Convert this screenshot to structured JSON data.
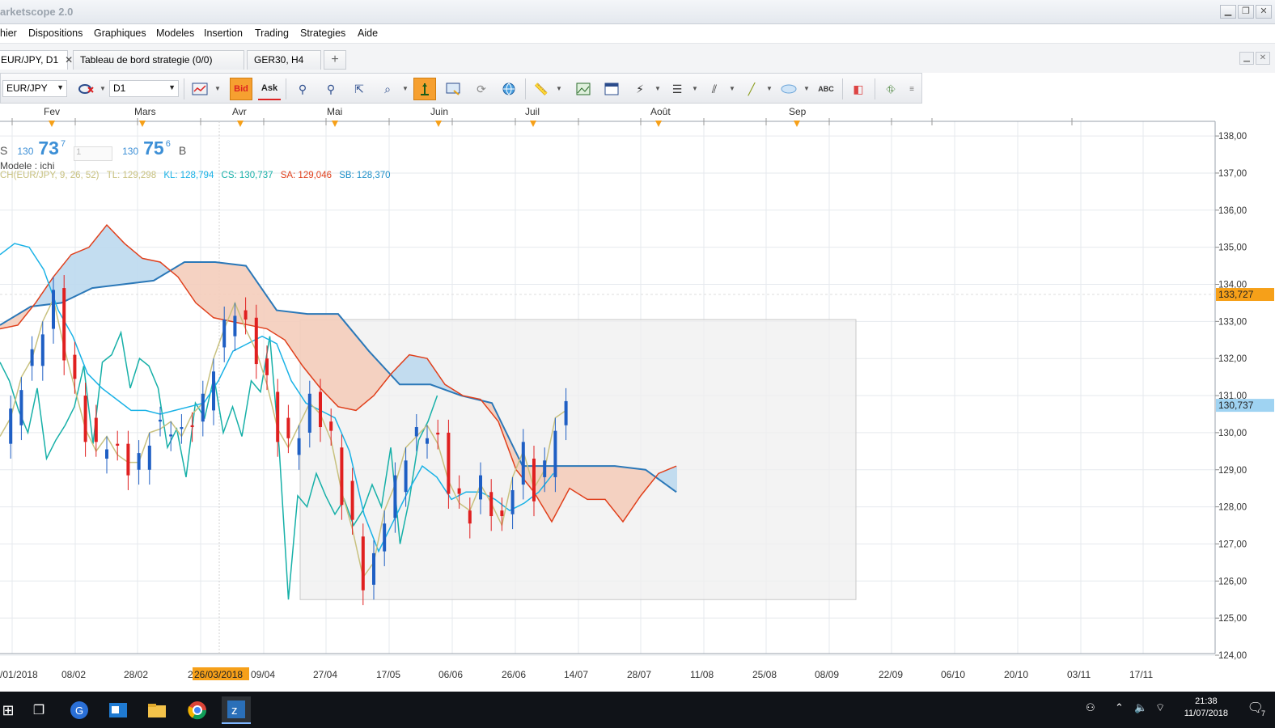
{
  "window": {
    "title": "arketscope 2.0",
    "buttons": [
      "▁",
      "❐",
      "✕"
    ]
  },
  "menu": [
    "hier",
    "Dispositions",
    "Graphiques",
    "Modeles",
    "Insertion",
    "Trading",
    "Strategies",
    "Aide"
  ],
  "tabs": [
    {
      "label": "EUR/JPY, D1",
      "close": "✕"
    },
    {
      "label": "Tableau de bord strategie (0/0)",
      "close": ""
    },
    {
      "label": "GER30, H4",
      "close": ""
    }
  ],
  "tab_add": "+",
  "toolbar": {
    "symbol": "EUR/JPY",
    "timeframe": "D1",
    "bid_label": "Bid",
    "ask_label": "Ask",
    "abc_label": "ABC"
  },
  "quote": {
    "sell_prefix": "S",
    "sell_big": "130",
    "sell_main": "73",
    "sell_pip": "7",
    "amount": "1",
    "buy_big": "130",
    "buy_main": "75",
    "buy_pip": "6",
    "buy_suffix": "B",
    "model_label": "Modele : ichi"
  },
  "indicator_legend": {
    "name": "CH(EUR/JPY",
    "name_hidden": ", 9, 26, 52)",
    "tl": "TL: 129,298",
    "kl": "KL: 128,794",
    "cs": "CS: 130,737",
    "sa": "SA: 129,046",
    "sb": "SB: 128,370"
  },
  "colors": {
    "tenkan": "#c8c17f",
    "kijun": "#1ab2e6",
    "chikou": "#17b0a8",
    "senkou_a": "#e0401c",
    "senkou_b": "#2b78b8",
    "cloud_bull": "#bcd9ee",
    "cloud_bear": "#f4cdbb",
    "candle_up": "#1f5fc4",
    "candle_down": "#e02020",
    "price_marker": "#f6a019"
  },
  "chart_data": {
    "type": "line",
    "ylim": [
      124,
      138
    ],
    "y_ticks": [
      "138,00",
      "137,00",
      "136,00",
      "135,00",
      "134,00",
      "133,00",
      "132,00",
      "131,00",
      "130,00",
      "129,00",
      "128,00",
      "127,00",
      "126,00",
      "125,00",
      "124,00"
    ],
    "month_labels": [
      "Fev",
      "Mars",
      "Avr",
      "Mai",
      "Juin",
      "Juil",
      "Août",
      "Sep"
    ],
    "date_labels": [
      "/01/2018",
      "08/02",
      "28/02",
      "2",
      "09/04",
      "27/04",
      "17/05",
      "06/06",
      "26/06",
      "14/07",
      "28/07",
      "11/08",
      "25/08",
      "08/09",
      "22/09",
      "06/10",
      "20/10",
      "03/11",
      "17/11"
    ],
    "crosshair_date": "26/03/2018",
    "price_labels": [
      {
        "text": "133,727",
        "value": 133.727,
        "color": "#f6a019"
      },
      {
        "text": "130,737",
        "value": 130.737,
        "color": "#9fd3f2"
      }
    ],
    "series": [
      {
        "values": [
          129.9,
          130.4,
          131.5,
          132.0,
          133.0,
          133.6,
          132.3,
          131.2,
          130.1,
          129.5,
          129.9,
          129.4,
          129.2,
          129.2,
          130.0,
          130.1,
          130.3,
          129.9,
          130.5,
          130.8,
          132.0,
          132.8,
          133.5,
          132.8,
          132.2,
          131.3,
          130.1,
          129.6,
          130.2,
          130.8,
          130.5,
          129.8,
          128.4,
          127.4,
          126.1,
          126.5,
          127.9,
          128.6,
          129.6,
          129.9,
          130.2,
          129.7,
          128.7,
          128.1,
          127.9,
          128.6,
          128.1,
          127.5,
          128.8,
          129.5,
          128.5,
          129.0,
          130.4,
          130.6
        ]
      },
      {
        "values": [
          134.8,
          135.1,
          135.0,
          134.4,
          133.3,
          132.6,
          131.6,
          131.2,
          130.9,
          130.6,
          130.6,
          130.5,
          130.6,
          130.7,
          130.8,
          131.4,
          132.2,
          132.4,
          132.6,
          132.4,
          131.4,
          130.8,
          130.6,
          130.4,
          129.5,
          127.8,
          126.8,
          127.6,
          128.4,
          129.1,
          128.8,
          128.2,
          128.4,
          128.4,
          128.2,
          127.9,
          128.1,
          128.4,
          128.9
        ]
      },
      {
        "values": [
          134.4,
          134.8,
          134.8,
          133.9,
          133.8,
          133.5,
          133.0,
          132.6,
          132.4,
          132.0,
          131.2,
          131.0,
          130.8,
          130.7,
          130.8,
          130.9,
          131.1,
          131.2,
          131.2,
          131.3,
          131.3,
          130.2,
          129.6,
          128.7,
          128.2,
          128.0,
          127.9,
          128.0,
          128.1,
          128.3,
          128.5,
          128.5,
          128.8
        ]
      },
      {
        "values": [
          131.9,
          131.4,
          130.6,
          130.0,
          131.2,
          129.3,
          129.8,
          130.2,
          130.7,
          131.8,
          129.7,
          131.9,
          132.1,
          132.7,
          131.2,
          132.0,
          131.8,
          131.2,
          129.6,
          130.1,
          128.8,
          130.8,
          130.4,
          131.5,
          130.0,
          130.7,
          129.9,
          131.4,
          131.1,
          132.6,
          129.6,
          125.5,
          128.3,
          128.0,
          128.9,
          128.3,
          127.8,
          128.2,
          127.5,
          127.9,
          128.6,
          128.0,
          129.6,
          127.0,
          128.2,
          129.8,
          130.3,
          131.0
        ]
      },
      {
        "values": [
          132.8,
          132.9,
          133.5,
          134.2,
          134.8,
          135.0,
          135.6,
          135.1,
          134.7,
          134.6,
          134.2,
          133.5,
          133.1,
          133.0,
          132.9,
          132.8,
          132.5,
          131.8,
          131.2,
          130.7,
          130.6,
          131.0,
          131.6,
          132.1,
          132.0,
          131.3,
          131.0,
          130.9,
          130.3,
          129.0,
          128.4,
          127.6,
          128.5,
          128.2,
          128.2,
          127.6,
          128.3,
          128.9,
          129.1
        ]
      },
      {
        "values": [
          132.9,
          133.4,
          133.5,
          133.9,
          134.0,
          134.1,
          134.6,
          134.6,
          134.5,
          133.3,
          133.2,
          133.2,
          132.2,
          131.3,
          131.3,
          131.0,
          130.8,
          129.1,
          129.1,
          129.1,
          129.1,
          129.0,
          128.4
        ]
      }
    ]
  },
  "taskbar": {
    "time": "21:38",
    "date": "11/07/2018",
    "notif_count": "7"
  }
}
